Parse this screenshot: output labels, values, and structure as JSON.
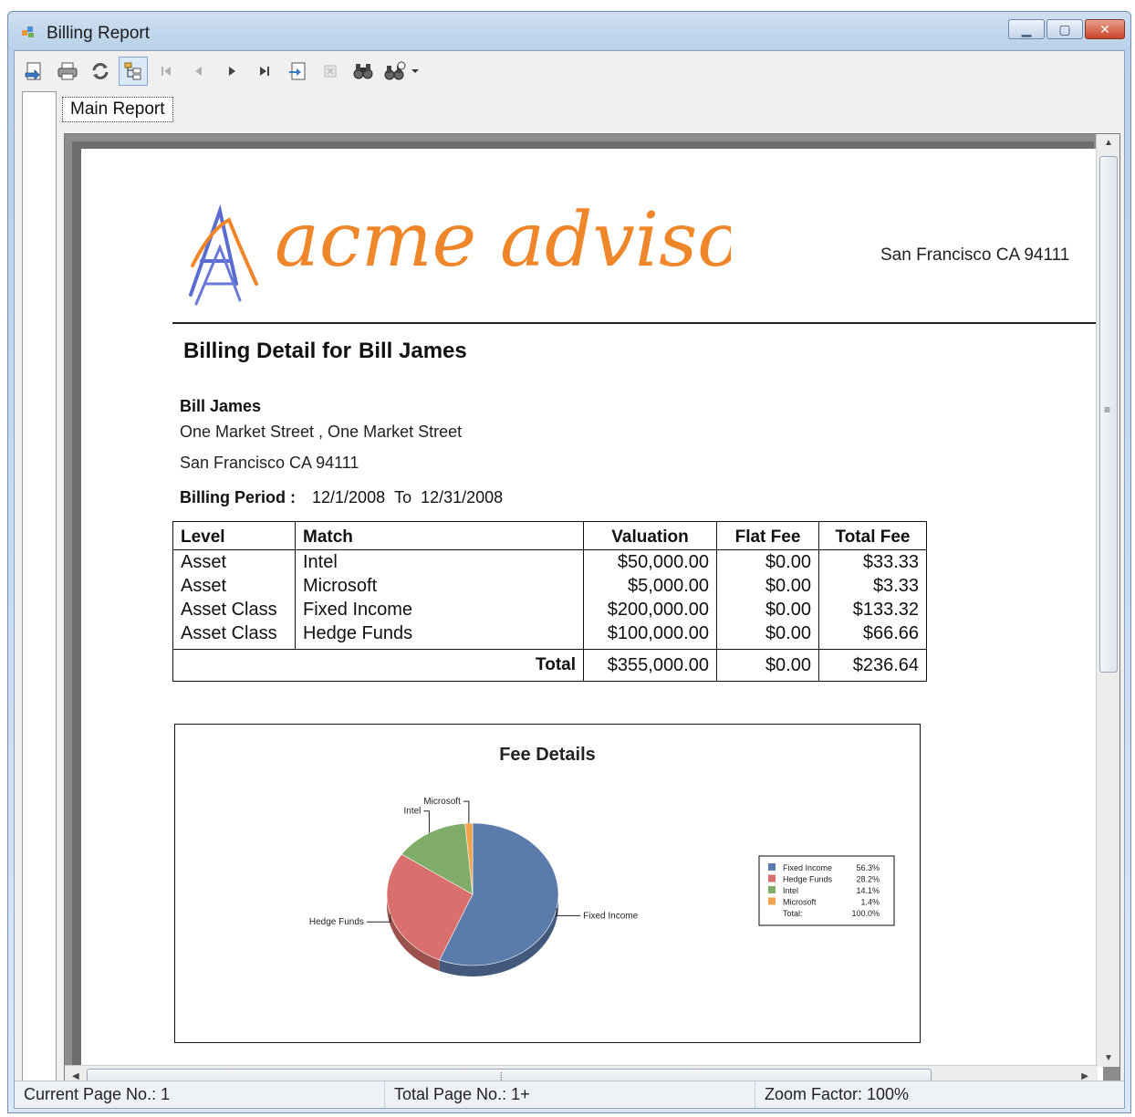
{
  "window": {
    "title": "Billing Report"
  },
  "toolbar": {
    "buttons": [
      "export-icon",
      "print-icon",
      "refresh-icon",
      "group-tree-icon",
      "first-page-icon",
      "previous-page-icon",
      "next-page-icon",
      "last-page-icon",
      "goto-page-icon",
      "stop-icon",
      "search-icon",
      "zoom-icon"
    ]
  },
  "tabs": {
    "main": "Main Report"
  },
  "report": {
    "company_logo": "acme advisors",
    "company_address": "San Francisco CA 94111",
    "heading_label": "Billing Detail for",
    "heading_name": "Bill James",
    "client": {
      "name": "Bill James",
      "street": "One Market Street , One Market Street",
      "city": "San Francisco CA 94111"
    },
    "period": {
      "label": "Billing Period :",
      "from": "12/1/2008",
      "to_label": "To",
      "to": "12/31/2008"
    },
    "table": {
      "headers": {
        "level": "Level",
        "match": "Match",
        "valuation": "Valuation",
        "flat_fee": "Flat Fee",
        "total_fee": "Total Fee"
      },
      "rows": [
        {
          "level": "Asset",
          "match": "Intel",
          "valuation": "$50,000.00",
          "flat_fee": "$0.00",
          "total_fee": "$33.33"
        },
        {
          "level": "Asset",
          "match": "Microsoft",
          "valuation": "$5,000.00",
          "flat_fee": "$0.00",
          "total_fee": "$3.33"
        },
        {
          "level": "Asset Class",
          "match": "Fixed Income",
          "valuation": "$200,000.00",
          "flat_fee": "$0.00",
          "total_fee": "$133.32"
        },
        {
          "level": "Asset Class",
          "match": "Hedge Funds",
          "valuation": "$100,000.00",
          "flat_fee": "$0.00",
          "total_fee": "$66.66"
        }
      ],
      "total": {
        "label": "Total",
        "valuation": "$355,000.00",
        "flat_fee": "$0.00",
        "total_fee": "$236.64"
      }
    }
  },
  "chart_data": {
    "type": "pie",
    "title": "Fee Details",
    "categories": [
      "Fixed Income",
      "Hedge Funds",
      "Intel",
      "Microsoft"
    ],
    "values": [
      56.3,
      28.2,
      14.1,
      1.4
    ],
    "value_labels": [
      "56.3%",
      "28.2%",
      "14.1%",
      "1.4%"
    ],
    "colors": [
      "#5b7bab",
      "#d9706d",
      "#80ac69",
      "#f0a34a"
    ],
    "legend": {
      "placement": "right",
      "total_label": "Total:",
      "total_value": "100.0%"
    }
  },
  "status": {
    "current_page": "Current Page No.: 1",
    "total_pages": "Total Page No.: 1+",
    "zoom": "Zoom Factor: 100%"
  }
}
